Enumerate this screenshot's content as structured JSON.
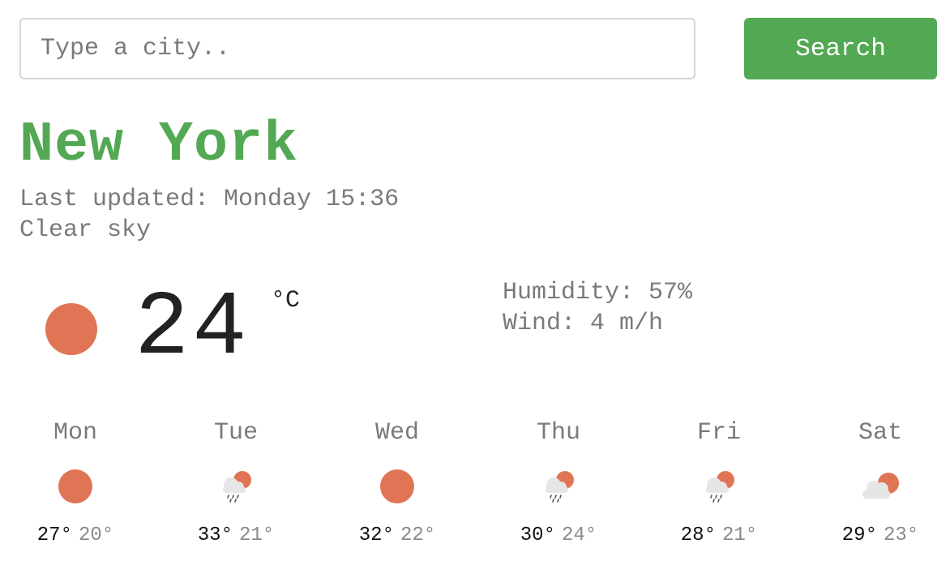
{
  "search": {
    "placeholder": "Type a city..",
    "value": "",
    "button_label": "Search"
  },
  "current": {
    "city": "New York",
    "updated_label": "Last updated: Monday 15:36",
    "description": "Clear sky",
    "icon": "sun-icon",
    "temperature": "24",
    "unit": "°C",
    "humidity": "Humidity: 57%",
    "wind": "Wind: 4 m/h"
  },
  "colors": {
    "accent": "#53a853",
    "sun": "#e07555",
    "cloud": "#e6e6e6",
    "muted_text": "#7a7a7a"
  },
  "forecast": [
    {
      "day": "Mon",
      "icon": "sun-icon",
      "max": "27°",
      "min": "20°"
    },
    {
      "day": "Tue",
      "icon": "sun-rain-cloud-icon",
      "max": "33°",
      "min": "21°"
    },
    {
      "day": "Wed",
      "icon": "sun-icon",
      "max": "32°",
      "min": "22°"
    },
    {
      "day": "Thu",
      "icon": "sun-rain-cloud-icon",
      "max": "30°",
      "min": "24°"
    },
    {
      "day": "Fri",
      "icon": "sun-rain-cloud-icon",
      "max": "28°",
      "min": "21°"
    },
    {
      "day": "Sat",
      "icon": "sun-cloud-icon",
      "max": "29°",
      "min": "23°"
    }
  ]
}
